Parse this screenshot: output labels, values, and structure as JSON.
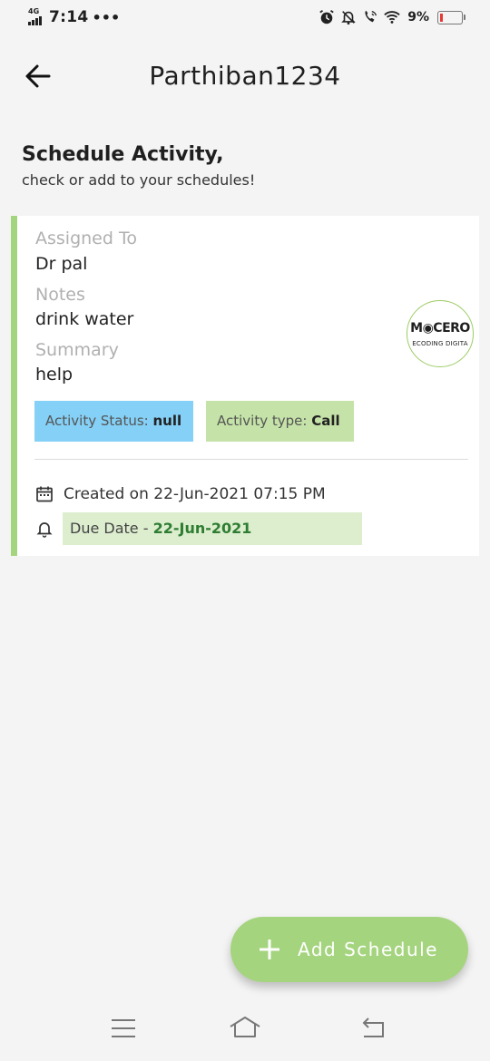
{
  "status_bar": {
    "network": "4G",
    "time": "7:14",
    "dots": "•••",
    "battery_percent": "9%",
    "icons": [
      "alarm-icon",
      "bell-off-icon",
      "wifi-call-icon",
      "wifi-icon",
      "battery-icon"
    ],
    "battery_level": 0.09
  },
  "header": {
    "title": "Parthiban1234",
    "back_icon": "arrow-left-icon"
  },
  "section": {
    "title": "Schedule Activity,",
    "subtitle": "check or add to your schedules!"
  },
  "card": {
    "accent_color": "#a5d47f",
    "assigned_to_label": "Assigned To",
    "assigned_to_value": "Dr pal",
    "notes_label": "Notes",
    "notes_value": "drink water",
    "summary_label": "Summary",
    "summary_value": "help",
    "logo_line1": "M◉CERO",
    "logo_line2": "ECODING DIGITA",
    "activity_status_label": "Activity Status:",
    "activity_status_value": "null",
    "activity_status_color": "#84d0f6",
    "activity_type_label": "Activity type:",
    "activity_type_value": "Call",
    "activity_type_color": "#c5e3a8",
    "created_text": "Created on 22-Jun-2021 07:15 PM",
    "due_label": "Due Date - ",
    "due_value": "22-Jun-2021"
  },
  "fab": {
    "label": "Add Schedule",
    "icon": "plus-icon",
    "color": "#a5d47f"
  },
  "nav_bar": {
    "icons": [
      "menu-icon",
      "home-icon",
      "back-icon"
    ]
  }
}
